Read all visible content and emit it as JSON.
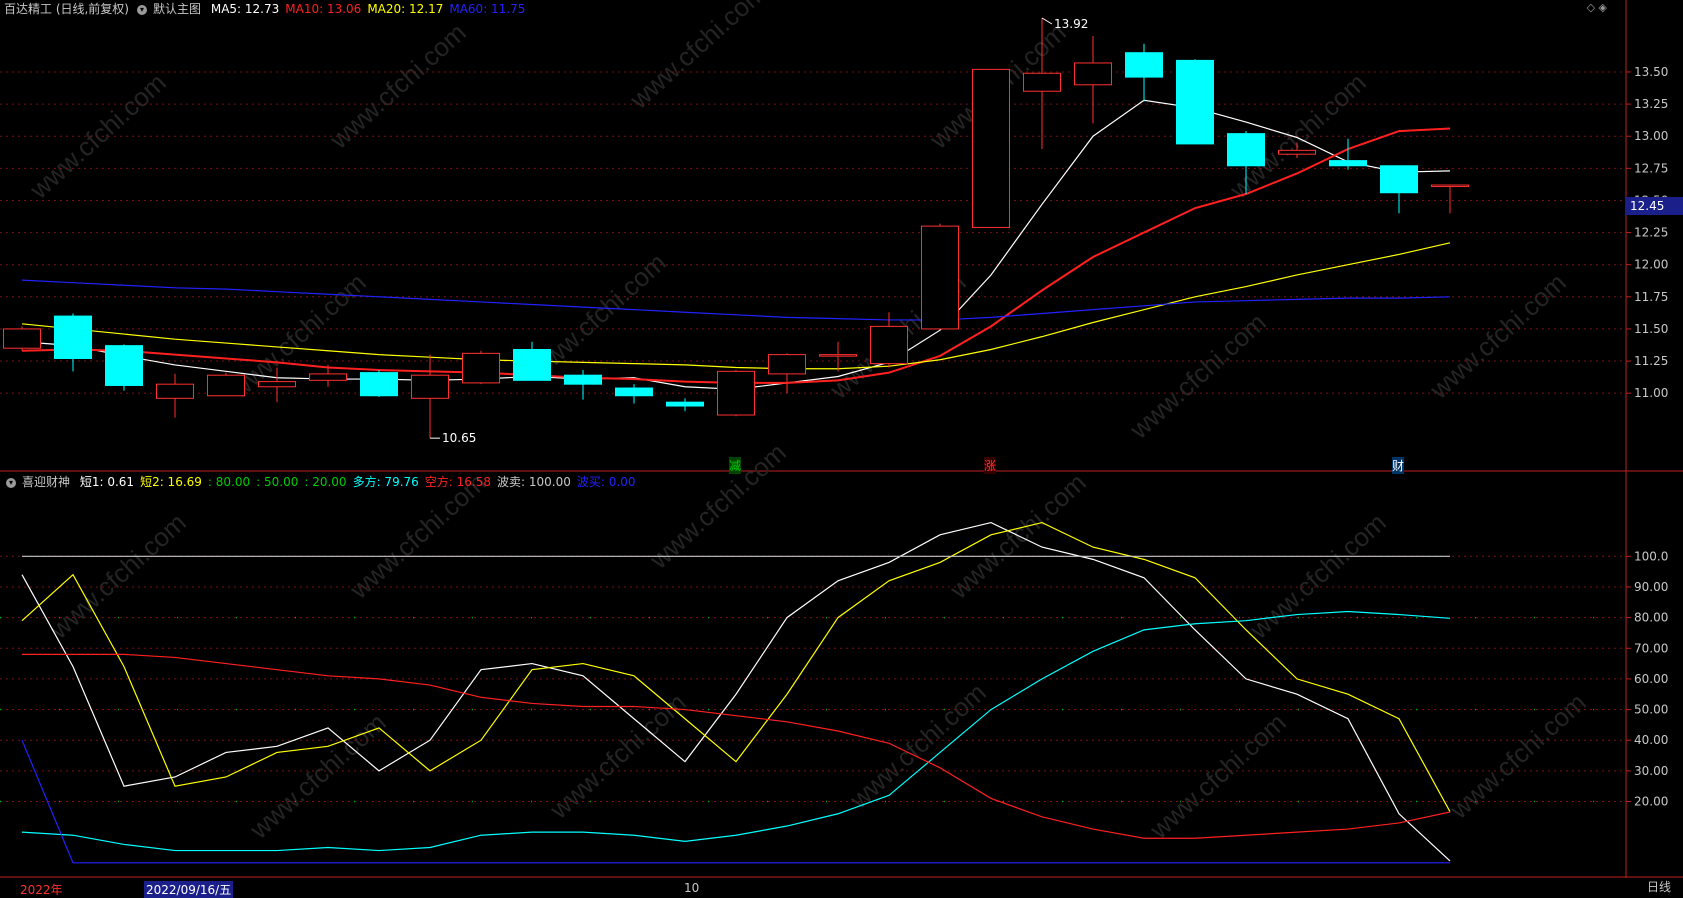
{
  "header": {
    "stock_title": "百达精工 (日线,前复权)",
    "main_chart_label": "默认主图",
    "ma": [
      {
        "label": "MA5: 12.73",
        "color": "#ffffff"
      },
      {
        "label": "MA10: 13.06",
        "color": "#ff2020"
      },
      {
        "label": "MA20: 12.17",
        "color": "#ffff00"
      },
      {
        "label": "MA60: 11.75",
        "color": "#2222ff"
      }
    ],
    "top_right_icons": "◇ ◈"
  },
  "indicator_header": {
    "name": "喜迎财神",
    "items": [
      {
        "label": "短1: 0.61",
        "color": "#ffffff"
      },
      {
        "label": "短2: 16.69",
        "color": "#ffff00"
      },
      {
        "label": ": 80.00",
        "color": "#00cc00"
      },
      {
        "label": ": 50.00",
        "color": "#00cc00"
      },
      {
        "label": ": 20.00",
        "color": "#00cc00"
      },
      {
        "label": "多方: 79.76",
        "color": "#00ffff"
      },
      {
        "label": "空方: 16.58",
        "color": "#ff2020"
      },
      {
        "label": "波卖: 100.00",
        "color": "#c8c8c8"
      },
      {
        "label": "波买: 0.00",
        "color": "#2222ff"
      }
    ]
  },
  "current_price": "12.45",
  "signals": [
    {
      "text": "减",
      "color": "#00cc00",
      "bg": "#004400",
      "index": 14
    },
    {
      "text": "涨",
      "color": "#ff3030",
      "bg": "#330000",
      "index": 19
    },
    {
      "text": "财",
      "color": "#ffffff",
      "bg": "#003366",
      "index": 27
    }
  ],
  "date_bar": {
    "year": "2022年",
    "cursor_date": "2022/09/16/五",
    "month": "10",
    "period": "日线"
  },
  "watermark": "www.cfchi.com",
  "chart_data": [
    {
      "type": "candlestick",
      "title": "默认主图",
      "ylim": [
        10.62,
        13.92
      ],
      "yticks": [
        11.0,
        11.25,
        11.5,
        11.75,
        12.0,
        12.25,
        12.5,
        12.75,
        13.0,
        13.25,
        13.5
      ],
      "ytick_labels": [
        "11.00",
        "11.25",
        "11.50",
        "11.75",
        "12.00",
        "12.25",
        "12.50",
        "12.75",
        "13.00",
        "13.25",
        "13.50"
      ],
      "annotations": [
        {
          "text": "13.92",
          "index": 20
        },
        {
          "text": "10.65",
          "index": 8
        }
      ],
      "candles": [
        {
          "o": 11.35,
          "h": 11.52,
          "l": 11.33,
          "c": 11.5
        },
        {
          "o": 11.6,
          "h": 11.62,
          "l": 11.17,
          "c": 11.27
        },
        {
          "o": 11.37,
          "h": 11.38,
          "l": 11.02,
          "c": 11.06
        },
        {
          "o": 10.96,
          "h": 11.15,
          "l": 10.81,
          "c": 11.07
        },
        {
          "o": 10.98,
          "h": 11.16,
          "l": 10.98,
          "c": 11.14
        },
        {
          "o": 11.05,
          "h": 11.2,
          "l": 10.93,
          "c": 11.09
        },
        {
          "o": 11.1,
          "h": 11.22,
          "l": 11.05,
          "c": 11.15
        },
        {
          "o": 11.16,
          "h": 11.18,
          "l": 10.97,
          "c": 10.98
        },
        {
          "o": 10.96,
          "h": 11.3,
          "l": 10.65,
          "c": 11.14
        },
        {
          "o": 11.08,
          "h": 11.33,
          "l": 11.07,
          "c": 11.31
        },
        {
          "o": 11.34,
          "h": 11.4,
          "l": 11.12,
          "c": 11.1
        },
        {
          "o": 11.14,
          "h": 11.18,
          "l": 10.95,
          "c": 11.07
        },
        {
          "o": 11.04,
          "h": 11.07,
          "l": 10.92,
          "c": 10.98
        },
        {
          "o": 10.93,
          "h": 10.96,
          "l": 10.86,
          "c": 10.9
        },
        {
          "o": 10.83,
          "h": 11.18,
          "l": 10.82,
          "c": 11.17
        },
        {
          "o": 11.15,
          "h": 11.31,
          "l": 11.0,
          "c": 11.3
        },
        {
          "o": 11.3,
          "h": 11.4,
          "l": 11.17,
          "c": 11.3
        },
        {
          "o": 11.23,
          "h": 11.63,
          "l": 11.2,
          "c": 11.52
        },
        {
          "o": 11.5,
          "h": 12.32,
          "l": 11.5,
          "c": 12.3
        },
        {
          "o": 12.29,
          "h": 13.52,
          "l": 12.29,
          "c": 13.52
        },
        {
          "o": 13.35,
          "h": 13.92,
          "l": 12.9,
          "c": 13.49
        },
        {
          "o": 13.4,
          "h": 13.78,
          "l": 13.1,
          "c": 13.57
        },
        {
          "o": 13.65,
          "h": 13.72,
          "l": 13.27,
          "c": 13.46
        },
        {
          "o": 13.59,
          "h": 13.6,
          "l": 12.95,
          "c": 12.94
        },
        {
          "o": 13.02,
          "h": 13.04,
          "l": 12.55,
          "c": 12.77
        },
        {
          "o": 12.86,
          "h": 12.95,
          "l": 12.83,
          "c": 12.89
        },
        {
          "o": 12.81,
          "h": 12.98,
          "l": 12.74,
          "c": 12.77
        },
        {
          "o": 12.77,
          "h": 12.77,
          "l": 12.4,
          "c": 12.56
        },
        {
          "o": 12.62,
          "h": 12.62,
          "l": 12.4,
          "c": 12.62
        }
      ],
      "series": [
        {
          "name": "MA5",
          "color": "#ffffff",
          "width": 1.2,
          "start": 0,
          "values": [
            11.4,
            11.37,
            11.29,
            11.22,
            11.17,
            11.12,
            11.11,
            11.11,
            11.1,
            11.11,
            11.13,
            11.11,
            11.12,
            11.05,
            11.03,
            11.08,
            11.13,
            11.24,
            11.49,
            11.92,
            12.47,
            13.0,
            13.28,
            13.22,
            13.11,
            12.99,
            12.8,
            12.72,
            12.73
          ]
        },
        {
          "name": "MA10",
          "color": "#ff2020",
          "width": 2,
          "start": 0,
          "values": [
            11.33,
            11.34,
            11.33,
            11.3,
            11.27,
            11.24,
            11.2,
            11.18,
            11.17,
            11.16,
            11.14,
            11.12,
            11.11,
            11.09,
            11.08,
            11.08,
            11.1,
            11.16,
            11.29,
            11.52,
            11.8,
            12.06,
            12.25,
            12.44,
            12.55,
            12.71,
            12.9,
            13.04,
            13.06
          ]
        },
        {
          "name": "MA20",
          "color": "#ffff00",
          "width": 1.2,
          "start": 0,
          "values": [
            11.54,
            11.5,
            11.46,
            11.42,
            11.39,
            11.36,
            11.33,
            11.3,
            11.28,
            11.26,
            11.25,
            11.24,
            11.23,
            11.22,
            11.2,
            11.19,
            11.19,
            11.21,
            11.26,
            11.34,
            11.44,
            11.55,
            11.65,
            11.75,
            11.83,
            11.92,
            12.0,
            12.08,
            12.17
          ]
        },
        {
          "name": "MA60",
          "color": "#2222ff",
          "width": 1.2,
          "start": 0,
          "values": [
            11.88,
            11.86,
            11.84,
            11.82,
            11.81,
            11.79,
            11.77,
            11.75,
            11.73,
            11.71,
            11.69,
            11.67,
            11.65,
            11.63,
            11.61,
            11.59,
            11.58,
            11.57,
            11.57,
            11.59,
            11.62,
            11.65,
            11.68,
            11.71,
            11.72,
            11.73,
            11.74,
            11.74,
            11.75
          ]
        }
      ]
    },
    {
      "type": "line",
      "title": "喜迎财神",
      "ylim": [
        -3,
        120
      ],
      "yticks": [
        20,
        30,
        40,
        50,
        60,
        70,
        80,
        90,
        100
      ],
      "ytick_labels": [
        "20.00",
        "30.00",
        "40.00",
        "50.00",
        "60.00",
        "70.00",
        "80.00",
        "90.00",
        "100.0"
      ],
      "series": [
        {
          "name": "短1",
          "color": "#ffffff",
          "values": [
            94,
            64,
            25,
            28,
            36,
            38,
            44,
            30,
            40,
            63,
            65,
            61,
            47,
            33,
            55,
            80,
            92,
            98,
            107,
            111,
            103,
            99,
            93,
            76,
            60,
            55,
            47,
            16,
            0.61
          ]
        },
        {
          "name": "短2",
          "color": "#ffff00",
          "values": [
            79,
            94,
            64,
            25,
            28,
            36,
            38,
            44,
            30,
            40,
            63,
            65,
            61,
            47,
            33,
            55,
            80,
            92,
            98,
            107,
            111,
            103,
            99,
            93,
            76,
            60,
            55,
            47,
            16.69
          ]
        },
        {
          "name": "多方",
          "color": "#00ffff",
          "values": [
            10,
            9,
            6,
            4,
            4,
            4,
            5,
            4,
            5,
            9,
            10,
            10,
            9,
            7,
            9,
            12,
            16,
            22,
            36,
            50,
            60,
            69,
            76,
            78,
            79,
            81,
            82,
            81,
            79.76
          ]
        },
        {
          "name": "空方",
          "color": "#ff2020",
          "values": [
            68,
            68,
            68,
            67,
            65,
            63,
            61,
            60,
            58,
            54,
            52,
            51,
            51,
            50,
            48,
            46,
            43,
            39,
            31,
            21,
            15,
            11,
            8,
            8,
            9,
            10,
            11,
            13,
            16.58
          ]
        },
        {
          "name": "波卖",
          "color": "#c8c8c8",
          "values": [
            100,
            100,
            100,
            100,
            100,
            100,
            100,
            100,
            100,
            100,
            100,
            100,
            100,
            100,
            100,
            100,
            100,
            100,
            100,
            100,
            100,
            100,
            100,
            100,
            100,
            100,
            100,
            100,
            100
          ]
        },
        {
          "name": "波买",
          "color": "#2222ff",
          "values": [
            40,
            0,
            0,
            0,
            0,
            0,
            0,
            0,
            0,
            0,
            0,
            0,
            0,
            0,
            0,
            0,
            0,
            0,
            0,
            0,
            0,
            0,
            0,
            0,
            0,
            0,
            0,
            0,
            0
          ]
        }
      ],
      "reference_levels": [
        20,
        50,
        80
      ]
    }
  ]
}
